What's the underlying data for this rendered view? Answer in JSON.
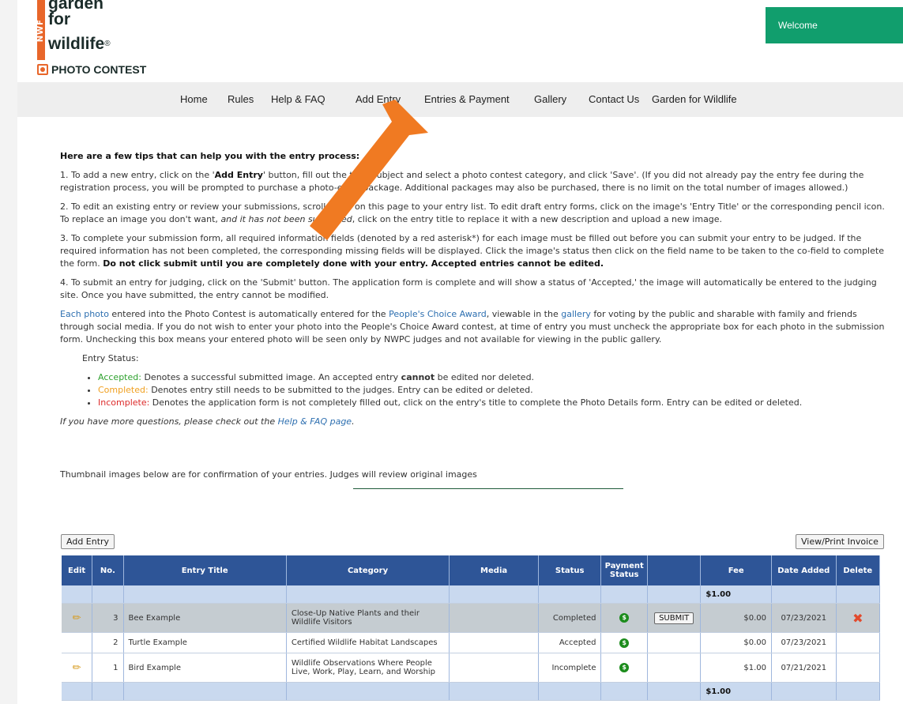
{
  "logo": {
    "nwf": "NWF",
    "line1": "garden",
    "line2": "for",
    "line3": "wildlife",
    "reg": "®",
    "photo_contest": "PHOTO CONTEST"
  },
  "welcome": "Welcome",
  "nav": [
    "Home",
    "Rules",
    "Help & FAQ",
    "Add Entry",
    "Entries & Payment",
    "Gallery",
    "Contact Us",
    "Garden for Wildlife"
  ],
  "tips": {
    "title": "Here are a few tips that can help you with the entry process:",
    "t1a": "1. To add a new entry, click on the '",
    "t1link": "Add Entry",
    "t1b": "' button, fill out the title, subject and select a photo contest category, and click 'Save'. (If you did not already pay the entry fee during the registration process, you will be prompted to purchase a photo-entry package. Additional packages may also be purchased, there is no limit on the total number of images allowed.)",
    "t2a": "2. To edit an existing entry or review your submissions, scroll down on this page to your entry list. To edit draft entry forms, click on the image's 'Entry Title' or the corresponding pencil icon. To replace an image you don't want, ",
    "t2i": "and it has not been submitted",
    "t2b": ", click on the entry title to replace it with a new description and upload a new image.",
    "t3a": "3. To complete your submission form, all required information fields (denoted by a red asterisk*) for each image must be filled out before you can submit your entry to be judged. If the required information has not been completed, the corresponding missing fields will be displayed. Click the image's status then click on the field name to be taken to the co-field to complete the form. ",
    "t3b": "Do not click submit until you are completely done with your entry. Accepted entries cannot be edited.",
    "t4": "4. To submit an entry for judging, click on the 'Submit' button. The application form is complete and will show a status of 'Accepted,' the image will automatically be entered to the judging site. Once you have submitted, the entry cannot be modified.",
    "pc_a": "Each photo",
    "pc_b": " entered into the Photo Contest is automatically entered for the ",
    "pc_c": "People's Choice Award",
    "pc_d": ", viewable in the ",
    "pc_e": "gallery",
    "pc_f": " for voting by the public and sharable with family and friends through social media. If you do not wish to enter your photo into the People's Choice Award contest, at time of entry you must uncheck the appropriate box for each photo in the submission form. Unchecking this box means your entered photo will be seen only by NWPC judges and not available for viewing in the public gallery."
  },
  "status": {
    "heading": "Entry Status:",
    "accepted": "Accepted:",
    "accepted_text_a": " Denotes a successful submitted image. An accepted entry ",
    "accepted_bold": "cannot",
    "accepted_text_b": " be edited nor deleted.",
    "completed": "Completed:",
    "completed_text": " Denotes entry still needs to be submitted to the judges. Entry can be edited or deleted.",
    "incomplete": "Incomplete:",
    "incomplete_text": " Denotes the application form is not completely filled out, click on the entry's title to complete the Photo Details form. Entry can be edited or deleted."
  },
  "faq": {
    "a": "If you have more questions, please check out the ",
    "link": "Help & FAQ page",
    "b": "."
  },
  "thumb_note": "Thumbnail images below are for confirmation of your entries. Judges will review original images",
  "buttons": {
    "add_entry": "Add Entry",
    "view_invoice": "View/Print Invoice"
  },
  "table": {
    "headers": [
      "Edit",
      "No.",
      "Entry Title",
      "Category",
      "Media",
      "Status",
      "Payment Status",
      "",
      "Fee",
      "Date Added",
      "Delete"
    ],
    "top_total": "$1.00",
    "rows": [
      {
        "no": "3",
        "title": "Bee Example",
        "category": "Close-Up Native Plants and their Wildlife Visitors",
        "status": "Completed",
        "submit": "SUBMIT",
        "fee": "$0.00",
        "date": "07/23/2021"
      },
      {
        "no": "2",
        "title": "Turtle Example",
        "category": "Certified Wildlife Habitat Landscapes",
        "status": "Accepted",
        "fee": "$0.00",
        "date": "07/23/2021"
      },
      {
        "no": "1",
        "title": "Bird Example",
        "category": "Wildlife Observations Where People Live, Work, Play, Learn, and Worship",
        "status": "Incomplete",
        "fee": "$1.00",
        "date": "07/21/2021"
      }
    ],
    "bottom_total": "$1.00"
  },
  "colors": {
    "nav_bg": "#eeeeee",
    "welcome_bg": "#119e6d",
    "table_header": "#2e5597",
    "arrow": "#f07a22"
  }
}
